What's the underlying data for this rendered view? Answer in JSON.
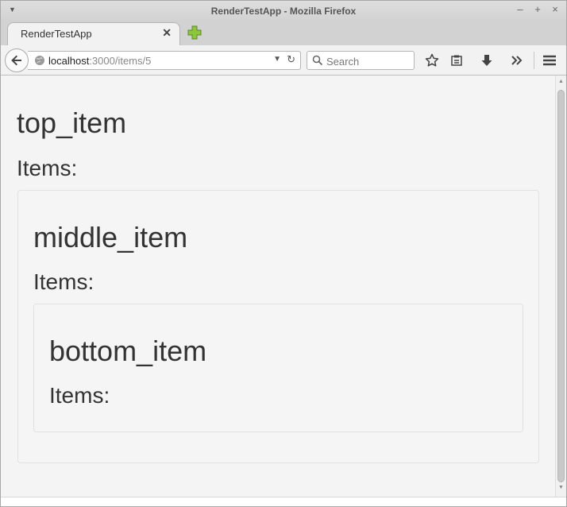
{
  "window": {
    "title": "RenderTestApp - Mozilla Firefox",
    "controls": [
      "–",
      "+",
      "×"
    ]
  },
  "tab": {
    "title": "RenderTestApp",
    "close_icon": "close-icon"
  },
  "urlbar": {
    "host": "localhost",
    "path": ":3000/items/5"
  },
  "search": {
    "placeholder": "Search"
  },
  "page": {
    "top": {
      "name": "top_item",
      "items_label": "Items:"
    },
    "middle": {
      "name": "middle_item",
      "items_label": "Items:"
    },
    "bottom": {
      "name": "bottom_item",
      "items_label": "Items:"
    }
  },
  "colors": {
    "text": "#333333",
    "well_border": "#e1e1e1",
    "page_bg": "#f4f4f4",
    "newtab_green": "#7ab72b"
  }
}
